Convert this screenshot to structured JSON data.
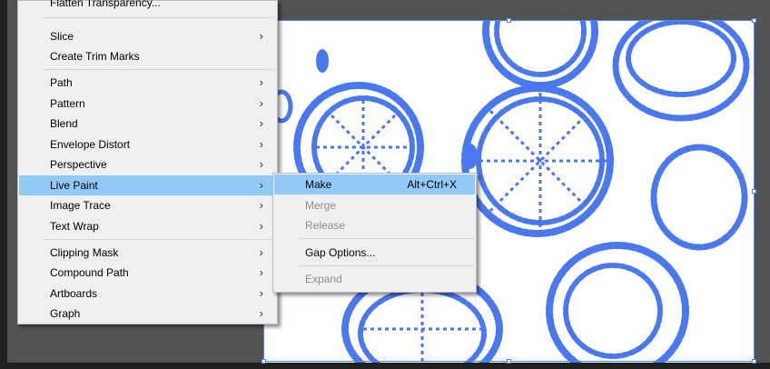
{
  "menu": {
    "items": [
      {
        "label": "Flatten Transparency...",
        "has_submenu": false
      },
      {
        "label": "Slice",
        "has_submenu": true
      },
      {
        "label": "Create Trim Marks",
        "has_submenu": false
      },
      {
        "label": "Path",
        "has_submenu": true
      },
      {
        "label": "Pattern",
        "has_submenu": true
      },
      {
        "label": "Blend",
        "has_submenu": true
      },
      {
        "label": "Envelope Distort",
        "has_submenu": true
      },
      {
        "label": "Perspective",
        "has_submenu": true
      },
      {
        "label": "Live Paint",
        "has_submenu": true,
        "highlighted": true
      },
      {
        "label": "Image Trace",
        "has_submenu": true
      },
      {
        "label": "Text Wrap",
        "has_submenu": true
      },
      {
        "label": "Clipping Mask",
        "has_submenu": true
      },
      {
        "label": "Compound Path",
        "has_submenu": true
      },
      {
        "label": "Artboards",
        "has_submenu": true
      },
      {
        "label": "Graph",
        "has_submenu": true
      }
    ],
    "submenu_arrow": "›"
  },
  "submenu": {
    "items": [
      {
        "label": "Make",
        "shortcut": "Alt+Ctrl+X",
        "highlighted": true
      },
      {
        "label": "Merge",
        "disabled": true
      },
      {
        "label": "Release",
        "disabled": true
      },
      {
        "label": "Gap Options..."
      },
      {
        "label": "Expand",
        "disabled": true
      }
    ]
  },
  "colors": {
    "artwork_stroke": "#4a78f0",
    "highlight": "#91c9f7",
    "selection": "#4a86ff"
  }
}
